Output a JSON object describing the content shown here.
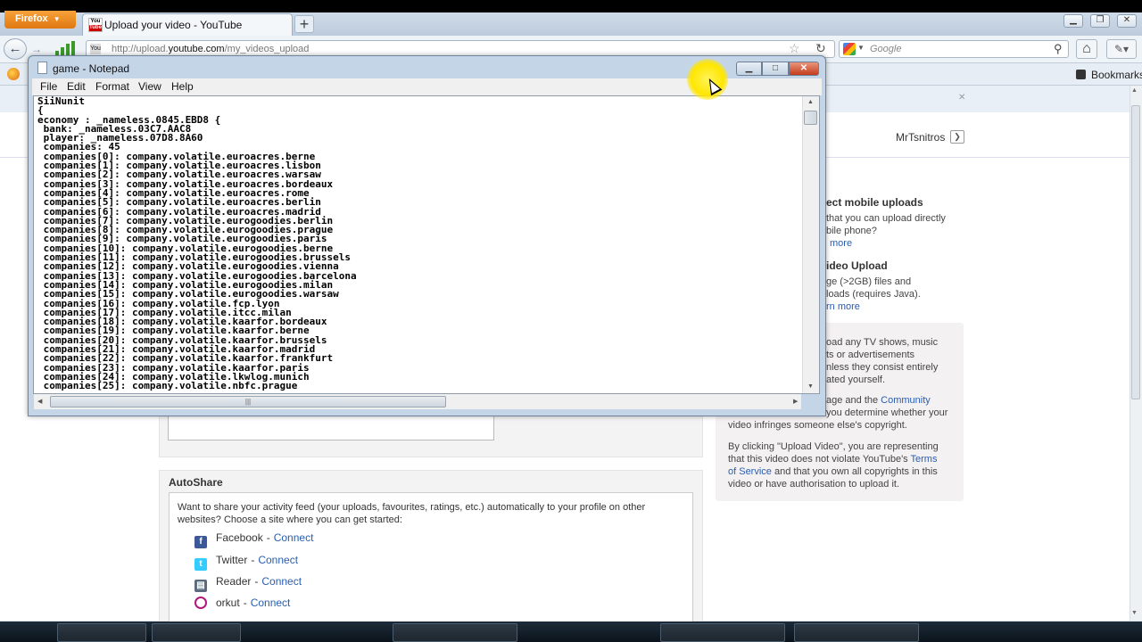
{
  "browser": {
    "app_button": "Firefox",
    "tab_title": "Upload your video - YouTube",
    "url_prefix": "http://upload.",
    "url_domain": "youtube.com",
    "url_path": "/my_videos_upload",
    "search_placeholder": "Google",
    "bookmarks_label": "Bookmarks",
    "new_tab": "+"
  },
  "notepad": {
    "title": "game - Notepad",
    "menu": [
      "File",
      "Edit",
      "Format",
      "View",
      "Help"
    ],
    "content": "SiiNunit\n{\neconomy : _nameless.0845.EBD8 {\n bank: _nameless.03C7.AAC8\n player: _nameless.07D8.8A60\n companies: 45\n companies[0]: company.volatile.euroacres.berne\n companies[1]: company.volatile.euroacres.lisbon\n companies[2]: company.volatile.euroacres.warsaw\n companies[3]: company.volatile.euroacres.bordeaux\n companies[4]: company.volatile.euroacres.rome\n companies[5]: company.volatile.euroacres.berlin\n companies[6]: company.volatile.euroacres.madrid\n companies[7]: company.volatile.eurogoodies.berlin\n companies[8]: company.volatile.eurogoodies.prague\n companies[9]: company.volatile.eurogoodies.paris\n companies[10]: company.volatile.eurogoodies.berne\n companies[11]: company.volatile.eurogoodies.brussels\n companies[12]: company.volatile.eurogoodies.vienna\n companies[13]: company.volatile.eurogoodies.barcelona\n companies[14]: company.volatile.eurogoodies.milan\n companies[15]: company.volatile.eurogoodies.warsaw\n companies[16]: company.volatile.fcp.lyon\n companies[17]: company.volatile.itcc.milan\n companies[18]: company.volatile.kaarfor.bordeaux\n companies[19]: company.volatile.kaarfor.berne\n companies[20]: company.volatile.kaarfor.brussels\n companies[21]: company.volatile.kaarfor.madrid\n companies[22]: company.volatile.kaarfor.frankfurt\n companies[23]: company.volatile.kaarfor.paris\n companies[24]: company.volatile.lkwlog.munich\n companies[25]: company.volatile.nbfc.prague"
  },
  "youtube": {
    "user_name": "MrTsnitros",
    "mobile_heading": "ect mobile uploads",
    "mobile_line1": "that you can upload directly",
    "mobile_line2": "bile phone?",
    "mobile_more": "more",
    "video_upload_heading": "ideo Upload",
    "video_upload_line1": "ge (>2GB) files and",
    "video_upload_line2": "loads (requires Java).",
    "video_upload_more": "rn more",
    "policy_line1": "oad any TV shows, music",
    "policy_line2": "ts or advertisements",
    "policy_line3": "nless they consist entirely",
    "policy_line4": "ated yourself.",
    "guidelines_pre": "age and the ",
    "guidelines_link": "Community",
    "guidelines_line2": "you determine whether your",
    "guidelines_line3": "video infringes someone else's copyright.",
    "terms_line1": "By clicking \"Upload Video\", you are representing",
    "terms_line2": "that this video does not violate YouTube's ",
    "terms_link1": "Terms",
    "terms_link2": "of Service",
    "terms_line3": " and that you own all copyrights in this",
    "terms_line4": "video or have authorisation to upload it.",
    "autoshare_title": "AutoShare",
    "autoshare_desc": "Want to share your activity feed (your uploads, favourites, ratings, etc.) automatically to your profile on other websites? Choose a site where you can get started:",
    "services": [
      {
        "name": "Facebook",
        "action": "Connect"
      },
      {
        "name": "Twitter",
        "action": "Connect"
      },
      {
        "name": "Reader",
        "action": "Connect"
      },
      {
        "name": "orkut",
        "action": "Connect"
      }
    ]
  },
  "icons": {
    "back": "back-arrow-icon",
    "forward": "forward-arrow-icon",
    "star": "bookmark-star-icon",
    "reload": "reload-icon",
    "search": "magnifier-icon",
    "home": "home-icon"
  },
  "colors": {
    "firefox_orange": "#e8851c",
    "link_blue": "#2a5db0",
    "notepad_close_red": "#c43b1c"
  }
}
